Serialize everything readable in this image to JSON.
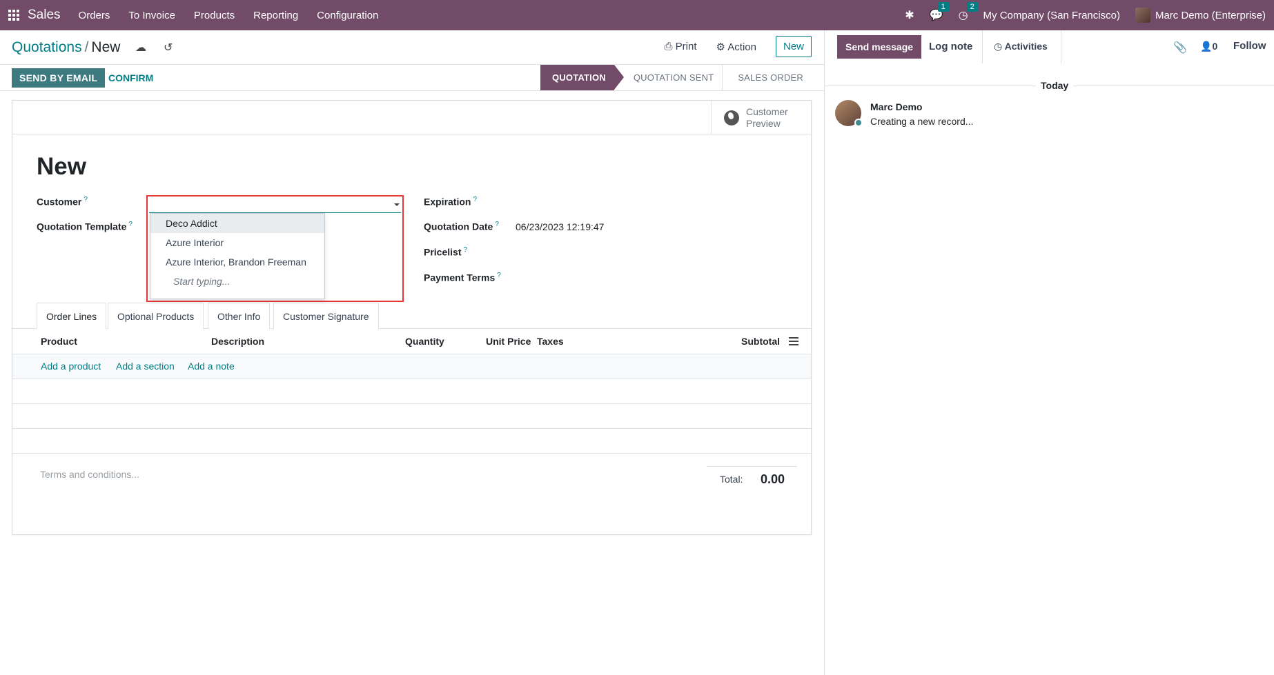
{
  "navbar": {
    "app": "Sales",
    "menu": [
      "Orders",
      "To Invoice",
      "Products",
      "Reporting",
      "Configuration"
    ],
    "messages_count": "1",
    "activities_count": "2",
    "company": "My Company (San Francisco)",
    "user": "Marc Demo (Enterprise)"
  },
  "breadcrumb": {
    "parent": "Quotations",
    "current": "New"
  },
  "actions": {
    "print": "Print",
    "action": "Action",
    "new": "New"
  },
  "statusbar": {
    "send_email": "SEND BY EMAIL",
    "confirm": "CONFIRM",
    "stages": [
      "QUOTATION",
      "QUOTATION SENT",
      "SALES ORDER"
    ]
  },
  "form": {
    "customer_preview": [
      "Customer",
      "Preview"
    ],
    "title": "New",
    "labels": {
      "customer": "Customer",
      "quotation_template": "Quotation Template",
      "expiration": "Expiration",
      "quotation_date": "Quotation Date",
      "pricelist": "Pricelist",
      "payment_terms": "Payment Terms"
    },
    "quotation_date_value": "06/23/2023 12:19:47",
    "customer_dropdown": [
      "Deco Addict",
      "Azure Interior",
      "Azure Interior, Brandon Freeman"
    ],
    "dropdown_hint": "Start typing..."
  },
  "tabs": [
    "Order Lines",
    "Optional Products",
    "Other Info",
    "Customer Signature"
  ],
  "table": {
    "columns": [
      "Product",
      "Description",
      "Quantity",
      "Unit Price",
      "Taxes",
      "Subtotal"
    ],
    "add_product": "Add a product",
    "add_section": "Add a section",
    "add_note": "Add a note"
  },
  "footer": {
    "terms_placeholder": "Terms and conditions...",
    "total_label": "Total:",
    "total_value": "0.00"
  },
  "chatter": {
    "send_message": "Send message",
    "log_note": "Log note",
    "activities": "Activities",
    "followers": "0",
    "follow": "Follow",
    "today": "Today",
    "author": "Marc Demo",
    "message": "Creating a new record..."
  },
  "colors": {
    "brand": "#714B67",
    "accent": "#017e84",
    "highlight": "#e53935"
  }
}
